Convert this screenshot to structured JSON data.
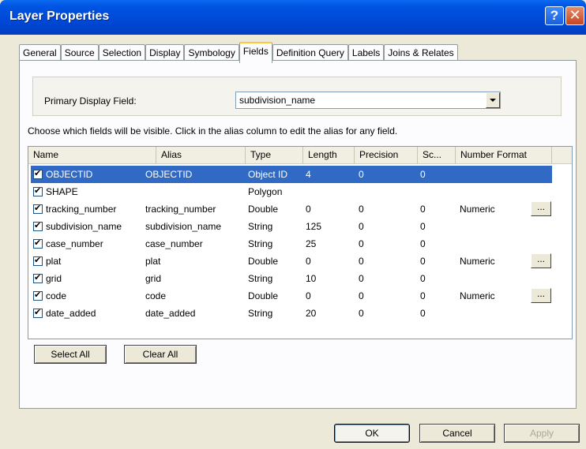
{
  "window": {
    "title": "Layer Properties",
    "help": "?",
    "close": "✕"
  },
  "tabs": [
    "General",
    "Source",
    "Selection",
    "Display",
    "Symbology",
    "Fields",
    "Definition Query",
    "Labels",
    "Joins & Relates"
  ],
  "active_tab": "Fields",
  "primary_display": {
    "label": "Primary Display Field:",
    "value": "subdivision_name"
  },
  "instruction": "Choose which fields will be visible. Click in the alias column to edit the alias for any field.",
  "table": {
    "headers": [
      "Name",
      "Alias",
      "Type",
      "Length",
      "Precision",
      "Sc...",
      "Number Format"
    ],
    "rows": [
      {
        "name": "OBJECTID",
        "alias": "OBJECTID",
        "type": "Object ID",
        "length": "4",
        "precision": "0",
        "scale": "0",
        "format": "",
        "checked": true,
        "selected": true,
        "has_format_btn": false
      },
      {
        "name": "SHAPE",
        "alias": "",
        "type": "Polygon",
        "length": "",
        "precision": "",
        "scale": "",
        "format": "",
        "checked": true,
        "selected": false,
        "has_format_btn": false
      },
      {
        "name": "tracking_number",
        "alias": "tracking_number",
        "type": "Double",
        "length": "0",
        "precision": "0",
        "scale": "0",
        "format": "Numeric",
        "checked": true,
        "selected": false,
        "has_format_btn": true
      },
      {
        "name": "subdivision_name",
        "alias": "subdivision_name",
        "type": "String",
        "length": "125",
        "precision": "0",
        "scale": "0",
        "format": "",
        "checked": true,
        "selected": false,
        "has_format_btn": false
      },
      {
        "name": "case_number",
        "alias": "case_number",
        "type": "String",
        "length": "25",
        "precision": "0",
        "scale": "0",
        "format": "",
        "checked": true,
        "selected": false,
        "has_format_btn": false
      },
      {
        "name": "plat",
        "alias": "plat",
        "type": "Double",
        "length": "0",
        "precision": "0",
        "scale": "0",
        "format": "Numeric",
        "checked": true,
        "selected": false,
        "has_format_btn": true
      },
      {
        "name": "grid",
        "alias": "grid",
        "type": "String",
        "length": "10",
        "precision": "0",
        "scale": "0",
        "format": "",
        "checked": true,
        "selected": false,
        "has_format_btn": false
      },
      {
        "name": "code",
        "alias": "code",
        "type": "Double",
        "length": "0",
        "precision": "0",
        "scale": "0",
        "format": "Numeric",
        "checked": true,
        "selected": false,
        "has_format_btn": true
      },
      {
        "name": "date_added",
        "alias": "date_added",
        "type": "String",
        "length": "20",
        "precision": "0",
        "scale": "0",
        "format": "",
        "checked": true,
        "selected": false,
        "has_format_btn": false
      }
    ],
    "format_button_label": "..."
  },
  "buttons": {
    "select_all": "Select All",
    "clear_all": "Clear All",
    "ok": "OK",
    "cancel": "Cancel",
    "apply": "Apply"
  },
  "colors": {
    "title_bar": "#0054e3",
    "selection": "#316ac5",
    "dialog_bg": "#ece9d8",
    "active_tab_accent": "#ffc83c"
  }
}
